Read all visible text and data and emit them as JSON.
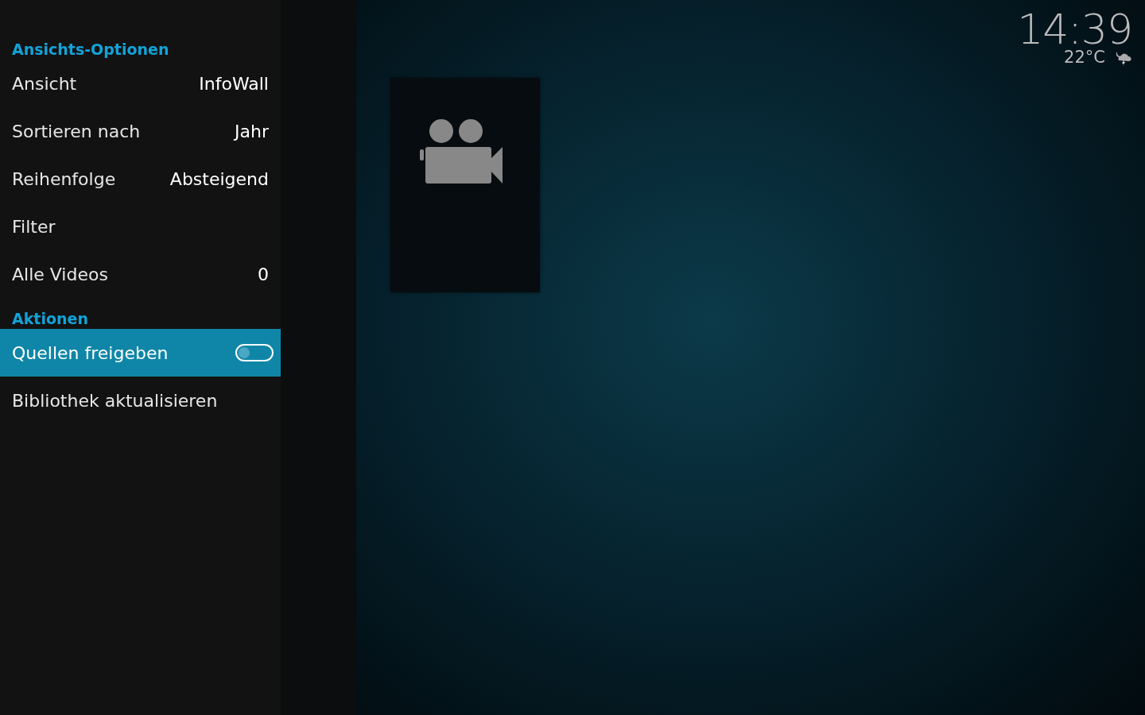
{
  "sidebar": {
    "sections": [
      {
        "title": "Ansichts-Optionen",
        "items": [
          {
            "kind": "value",
            "label": "Ansicht",
            "value": "InfoWall",
            "selected": false
          },
          {
            "kind": "value",
            "label": "Sortieren nach",
            "value": "Jahr",
            "selected": false
          },
          {
            "kind": "value",
            "label": "Reihenfolge",
            "value": "Absteigend",
            "selected": false
          },
          {
            "kind": "plain",
            "label": "Filter",
            "selected": false
          },
          {
            "kind": "value",
            "label": "Alle Videos",
            "value": "0",
            "selected": false
          }
        ]
      },
      {
        "title": "Aktionen",
        "items": [
          {
            "kind": "toggle",
            "label": "Quellen freigeben",
            "on": false,
            "selected": true
          },
          {
            "kind": "plain",
            "label": "Bibliothek aktualisieren",
            "selected": false
          }
        ]
      }
    ]
  },
  "clock": {
    "time": "14:39",
    "temperature": "22°C"
  }
}
